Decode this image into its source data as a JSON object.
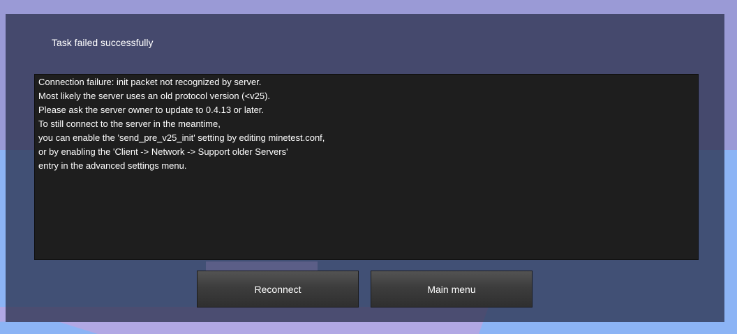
{
  "dialog": {
    "title": "Task failed successfully",
    "message_lines": [
      "Connection failure: init packet not recognized by server.",
      "Most likely the server uses an old protocol version (<v25).",
      "Please ask the server owner to update to 0.4.13 or later.",
      "To still connect to the server in the meantime,",
      "you can enable the 'send_pre_v25_init' setting by editing minetest.conf,",
      "or by enabling the 'Client -> Network -> Support older Servers'",
      "entry in the advanced settings menu."
    ],
    "buttons": {
      "reconnect": "Reconnect",
      "main_menu": "Main menu"
    }
  },
  "colors": {
    "sky_upper": "#9a9ad6",
    "sky_lower": "#8cb4f5",
    "dialog_overlay": "#242a44",
    "message_bg": "#1e1e1e",
    "button_bg": "#3d3d3d",
    "text": "#ffffff"
  }
}
